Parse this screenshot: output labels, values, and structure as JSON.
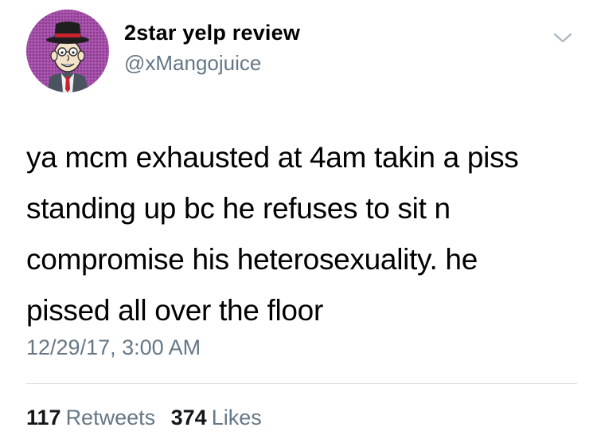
{
  "tweet": {
    "display_name": "2star yelp review",
    "handle": "@xMangojuice",
    "text_lines": [
      "ya mcm exhausted at 4am takin a piss",
      "standing up bc he refuses to sit n",
      "compromise his heterosexuality. he",
      "pissed all over the floor"
    ],
    "timestamp": "12/29/17, 3:00 AM",
    "retweets": {
      "count": "117",
      "label": "Retweets"
    },
    "likes": {
      "count": "374",
      "label": "Likes"
    }
  },
  "icons": {
    "avatar": "cartoon-man-with-hat-avatar",
    "menu": "chevron-down-icon"
  },
  "colors": {
    "text_primary": "#000000",
    "text_secondary": "#657786",
    "divider": "#d8dde2",
    "avatar_background": "#9c4aa0"
  }
}
